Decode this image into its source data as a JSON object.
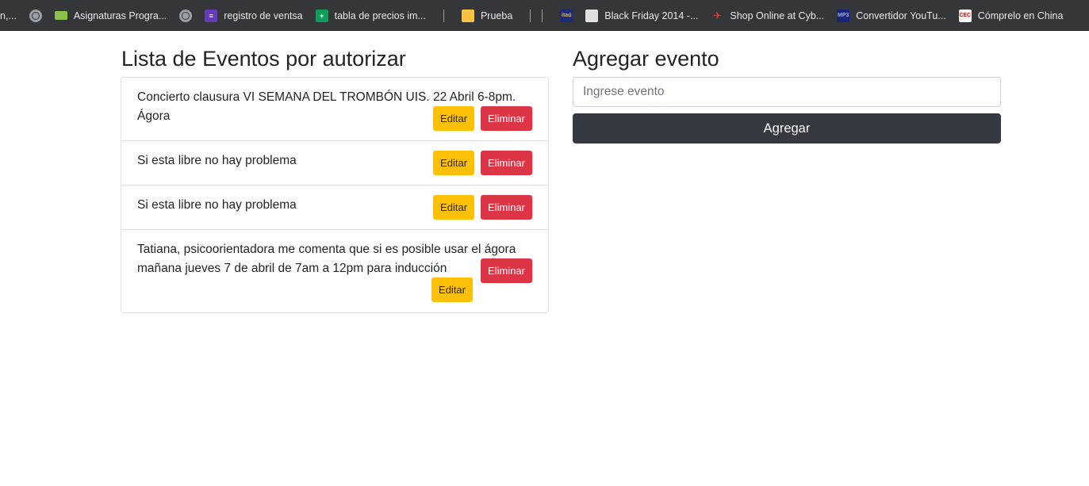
{
  "bookmarks": [
    {
      "label": "n,...",
      "icon": "none"
    },
    {
      "label": "",
      "icon": "globe-icon"
    },
    {
      "label": "Asignaturas Progra...",
      "icon": "card-icon"
    },
    {
      "label": "",
      "icon": "globe-icon"
    },
    {
      "label": "registro de ventsa",
      "icon": "form-icon"
    },
    {
      "label": "tabla de precios im...",
      "icon": "sheet-icon"
    },
    {
      "label": "Prueba",
      "icon": "folder-icon"
    },
    {
      "label": "Black Friday 2014 -...",
      "icon": "leaf-icon"
    },
    {
      "label": "Shop Online at Cyb...",
      "icon": "cyber-icon"
    },
    {
      "label": "Convertidor YouTu...",
      "icon": "youtube-converter-icon"
    },
    {
      "label": "Cómprelo en China",
      "icon": "cec-icon"
    }
  ],
  "bookmark_icon_text": {
    "sheet": "+",
    "form": "≡",
    "itau": "itaú",
    "cyber": "✈",
    "yt": "MP3",
    "cec": "CEC"
  },
  "events_panel": {
    "title": "Lista de Eventos por autorizar",
    "edit_label": "Editar",
    "delete_label": "Eliminar",
    "events": [
      {
        "text": "Concierto clausura VI SEMANA DEL TROMBÓN UIS. 22 Abril 6-8pm. Ágora"
      },
      {
        "text": "Si esta libre no hay problema"
      },
      {
        "text": "Si esta libre no hay problema"
      },
      {
        "text": "Tatiana, psicoorientadora me comenta que si es posible usar el ágora mañana jueves 7 de abril de 7am a 12pm para inducción"
      }
    ]
  },
  "add_panel": {
    "title": "Agregar evento",
    "input_placeholder": "Ingrese evento",
    "input_value": "",
    "add_label": "Agregar"
  },
  "colors": {
    "warning": "#ffc107",
    "danger": "#dc3545",
    "dark": "#343a40",
    "bookmarks_bg": "#35363a"
  }
}
